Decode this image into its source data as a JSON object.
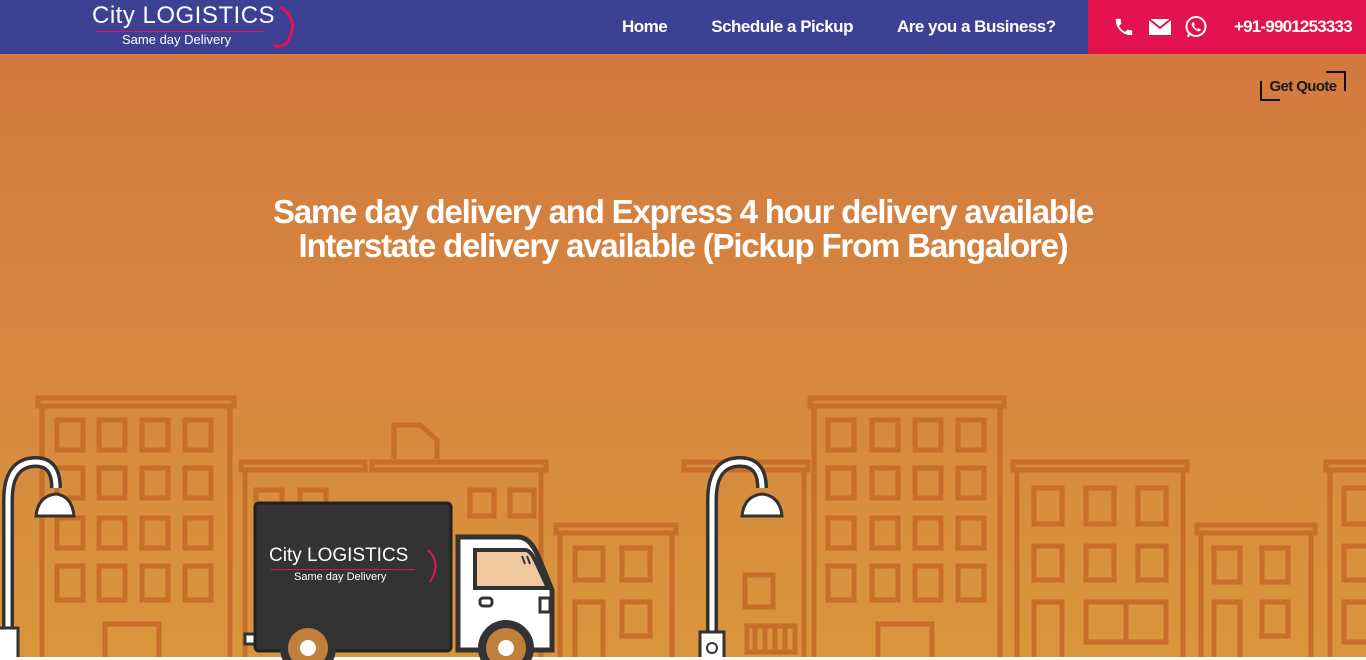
{
  "brand": {
    "name": "City LOGISTICS",
    "tagline": "Same day Delivery"
  },
  "nav": {
    "items": [
      {
        "label": "Home"
      },
      {
        "label": "Schedule a Pickup"
      },
      {
        "label": "Are you a Business?"
      }
    ]
  },
  "contact": {
    "icons": [
      "phone-icon",
      "mail-icon",
      "whatsapp-icon"
    ],
    "phone": "+91-9901253333"
  },
  "quote_button": {
    "label": "Get Quote"
  },
  "hero": {
    "line1": "Same day delivery and Express 4 hour delivery available",
    "line2": "Interstate delivery available (Pickup From Bangalore)"
  },
  "truck": {
    "brand_name": "City LOGISTICS",
    "brand_tagline": "Same day Delivery"
  },
  "colors": {
    "nav_bg": "#3c4193",
    "contact_bg": "#e1124d",
    "hero_top": "#d37740",
    "hero_bottom": "#d9953c",
    "building_line": "#c66e2a",
    "truck_box": "#333333"
  }
}
